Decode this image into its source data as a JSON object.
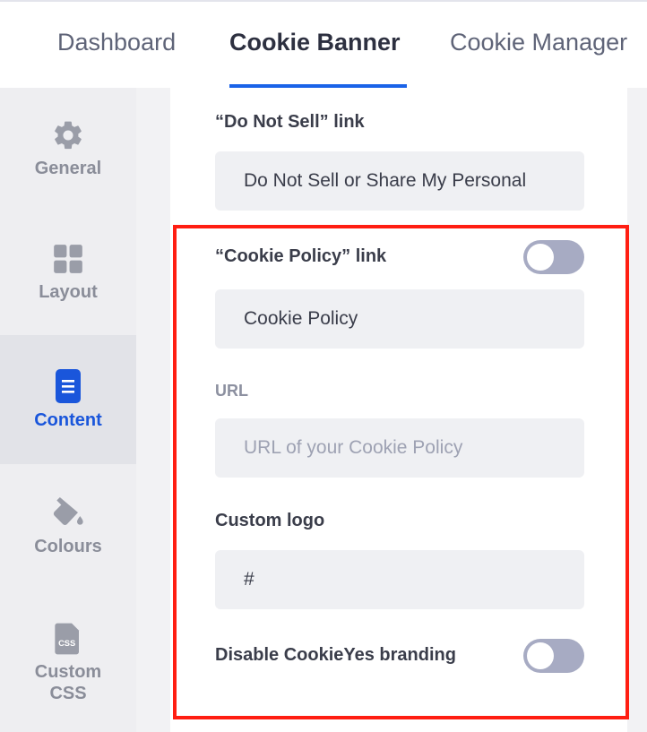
{
  "top_tabs": [
    {
      "label": "Dashboard"
    },
    {
      "label": "Cookie Banner"
    },
    {
      "label": "Cookie Manager"
    }
  ],
  "sidebar": {
    "items": [
      {
        "label": "General",
        "icon": "gear-icon"
      },
      {
        "label": "Layout",
        "icon": "grid-icon"
      },
      {
        "label": "Content",
        "icon": "document-icon"
      },
      {
        "label": "Colours",
        "icon": "paint-bucket-icon"
      },
      {
        "label": "Custom CSS",
        "icon": "css-file-icon"
      }
    ]
  },
  "content": {
    "do_not_sell": {
      "label": "“Do Not Sell” link",
      "value": "Do Not Sell or Share My Personal"
    },
    "cookie_policy": {
      "label": "“Cookie Policy” link",
      "enabled": false,
      "value": "Cookie Policy",
      "url_label": "URL",
      "url_placeholder": "URL of your Cookie Policy"
    },
    "custom_logo": {
      "label": "Custom logo",
      "value": "#"
    },
    "branding": {
      "label": "Disable CookieYes branding",
      "enabled": false
    }
  },
  "colors": {
    "accent": "#1a63e8",
    "highlight": "#ff1e12",
    "toggle_off": "#a7abc3"
  }
}
